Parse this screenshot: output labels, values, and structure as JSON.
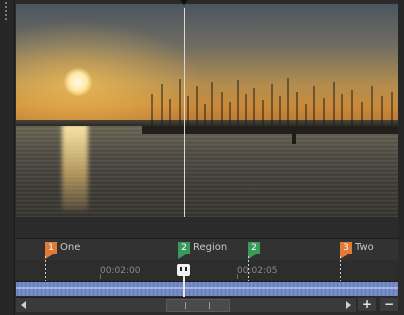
{
  "markers": [
    {
      "number": "1",
      "label": "One",
      "color": "#e07a34"
    },
    {
      "number": "2",
      "label": "Region",
      "color": "#3a9a5c"
    },
    {
      "number": "2",
      "label": "",
      "color": "#3a9a5c"
    },
    {
      "number": "3",
      "label": "Two",
      "color": "#e07a34"
    }
  ],
  "ruler": {
    "ticks": [
      "00:02:00",
      "00:02:05"
    ]
  },
  "icons": {
    "scroll_left": "arrow-left-icon",
    "scroll_right": "arrow-right-icon",
    "playhead": "playhead-icon"
  },
  "zoom": {
    "in_label": "+",
    "out_label": "−"
  }
}
